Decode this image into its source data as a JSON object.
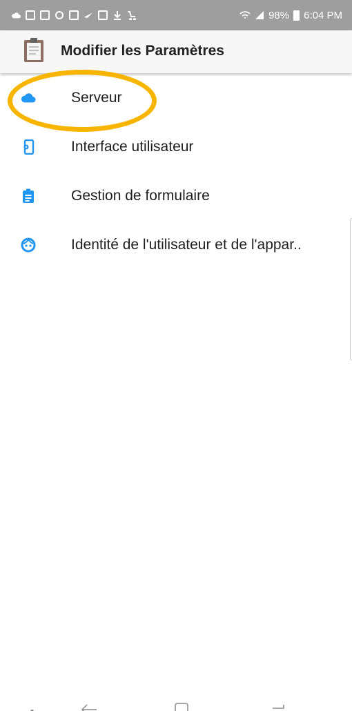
{
  "status_bar": {
    "battery_percent": "98%",
    "time": "6:04 PM",
    "icons": [
      "cloud-icon",
      "mail-icon",
      "mail-icon",
      "sync-icon",
      "app-icon",
      "nike-icon",
      "image-icon",
      "download-icon",
      "cart-icon",
      "wifi-icon",
      "signal-icon",
      "battery-icon"
    ]
  },
  "app_bar": {
    "title": "Modifier les Paramètres",
    "logo": "clipboard-icon"
  },
  "menu": {
    "items": [
      {
        "label": "Serveur",
        "icon": "cloud-icon"
      },
      {
        "label": "Interface utilisateur",
        "icon": "phone-settings-icon"
      },
      {
        "label": "Gestion de formulaire",
        "icon": "form-icon"
      },
      {
        "label": "Identité de l'utilisateur et de l'appar..",
        "icon": "face-icon"
      }
    ]
  },
  "colors": {
    "accent_blue": "#2196f3",
    "highlight": "#f7b500",
    "status_bar_bg": "#9e9e9e"
  }
}
